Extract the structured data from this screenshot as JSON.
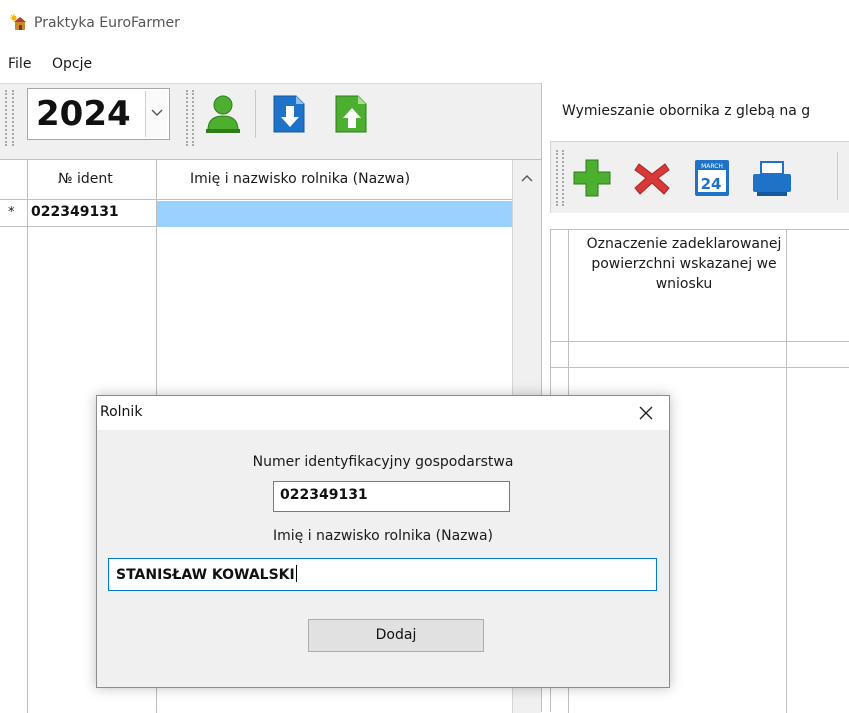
{
  "window": {
    "title": "Praktyka EuroFarmer"
  },
  "menu": {
    "items": [
      "File",
      "Opcje"
    ]
  },
  "toolbar": {
    "year": "2024",
    "icons": [
      "user-icon",
      "import-icon",
      "export-icon"
    ]
  },
  "grid": {
    "headers": [
      "№ ident",
      "Imię i nazwisko rolnika (Nazwa)"
    ],
    "rows": [
      {
        "marker": "*",
        "ident": "022349131",
        "name": ""
      }
    ]
  },
  "right_panel": {
    "task_label": "Wymieszanie obornika z glebą na g",
    "toolbar_icons": [
      "add-icon",
      "delete-icon",
      "calendar-icon",
      "printer-icon"
    ],
    "calendar_month": "MARCH",
    "calendar_day": "24",
    "grid_header": "Oznaczenie zadeklarowanej powierzchni wskazanej we wniosku"
  },
  "dialog": {
    "title": "Rolnik",
    "ident_label": "Numer identyfikacyjny gospodarstwa",
    "ident_value": "022349131",
    "name_label": "Imię i nazwisko rolnika (Nazwa)",
    "name_value": "STANISŁAW KOWALSKI",
    "add_button": "Dodaj"
  },
  "colors": {
    "selection": "#99d1ff",
    "focus_border": "#0078d7",
    "toolbar_bg": "#f0f0f0",
    "green_icon": "#4caf2f",
    "blue_icon": "#1e73c8",
    "red_icon": "#d93838"
  }
}
